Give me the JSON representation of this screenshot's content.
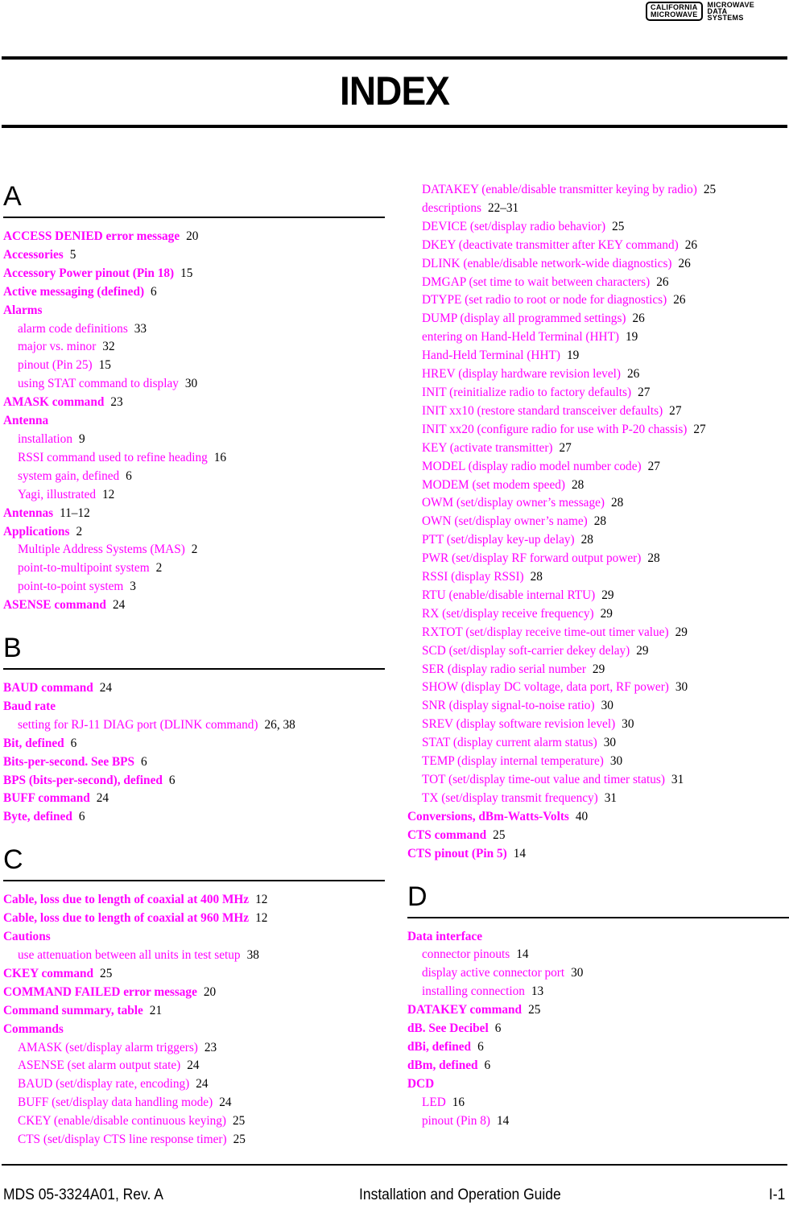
{
  "logo": {
    "box_line1": "CALIFORNIA",
    "box_line2": "MICROWAVE",
    "side_line1": "MICROWAVE",
    "side_line2": "DATA",
    "side_line3": "SYSTEMS"
  },
  "title": "INDEX",
  "colors": {
    "term": "#ff00ff",
    "pages": "#000000"
  },
  "sections": [
    {
      "letter": "A",
      "entries": [
        {
          "level": "main",
          "term": "ACCESS DENIED error message",
          "pages": "20"
        },
        {
          "level": "main",
          "term": "Accessories",
          "pages": "5"
        },
        {
          "level": "main",
          "term": "Accessory Power pinout (Pin 18)",
          "pages": "15"
        },
        {
          "level": "main",
          "term": "Active messaging (defined)",
          "pages": "6"
        },
        {
          "level": "main",
          "term": "Alarms",
          "pages": ""
        },
        {
          "level": "sub",
          "term": "alarm code definitions",
          "pages": "33"
        },
        {
          "level": "sub",
          "term": "major vs. minor",
          "pages": "32"
        },
        {
          "level": "sub",
          "term": "pinout (Pin 25)",
          "pages": "15"
        },
        {
          "level": "sub",
          "term": "using STAT command to display",
          "pages": "30"
        },
        {
          "level": "main",
          "term": "AMASK command",
          "pages": "23"
        },
        {
          "level": "main",
          "term": "Antenna",
          "pages": ""
        },
        {
          "level": "sub",
          "term": "installation",
          "pages": "9"
        },
        {
          "level": "sub",
          "term": "RSSI command used to refine heading",
          "pages": "16"
        },
        {
          "level": "sub",
          "term": "system gain, defined",
          "pages": "6"
        },
        {
          "level": "sub",
          "term": "Yagi, illustrated",
          "pages": "12"
        },
        {
          "level": "main",
          "term": "Antennas",
          "pages": "11–12"
        },
        {
          "level": "main",
          "term": "Applications",
          "pages": "2"
        },
        {
          "level": "sub",
          "term": "Multiple Address Systems (MAS)",
          "pages": "2"
        },
        {
          "level": "sub",
          "term": "point-to-multipoint system",
          "pages": "2"
        },
        {
          "level": "sub",
          "term": "point-to-point system",
          "pages": "3"
        },
        {
          "level": "main",
          "term": "ASENSE command",
          "pages": "24"
        }
      ]
    },
    {
      "letter": "B",
      "entries": [
        {
          "level": "main",
          "term": "BAUD command",
          "pages": "24"
        },
        {
          "level": "main",
          "term": "Baud rate",
          "pages": ""
        },
        {
          "level": "sub",
          "term": "setting for RJ-11 DIAG port (DLINK command)",
          "pages": "26, 38"
        },
        {
          "level": "main",
          "term": "Bit, defined",
          "pages": "6"
        },
        {
          "level": "main",
          "term": "Bits-per-second. See BPS",
          "pages": "6"
        },
        {
          "level": "main",
          "term": "BPS (bits-per-second), defined",
          "pages": "6"
        },
        {
          "level": "main",
          "term": "BUFF command",
          "pages": "24"
        },
        {
          "level": "main",
          "term": "Byte, defined",
          "pages": "6"
        }
      ]
    },
    {
      "letter": "C",
      "entries": [
        {
          "level": "main",
          "term": "Cable, loss due to length of coaxial at 400 MHz",
          "pages": "12"
        },
        {
          "level": "main",
          "term": "Cable, loss due to length of coaxial at 960 MHz",
          "pages": "12"
        },
        {
          "level": "main",
          "term": "Cautions",
          "pages": ""
        },
        {
          "level": "sub",
          "term": "use attenuation between all units in test setup",
          "pages": "38"
        },
        {
          "level": "main",
          "term": "CKEY command",
          "pages": "25"
        },
        {
          "level": "main",
          "term": "COMMAND FAILED error message",
          "pages": "20"
        },
        {
          "level": "main",
          "term": "Command summary, table",
          "pages": "21"
        },
        {
          "level": "main",
          "term": "Commands",
          "pages": ""
        },
        {
          "level": "sub",
          "term": "AMASK (set/display alarm triggers)",
          "pages": "23"
        },
        {
          "level": "sub",
          "term": "ASENSE (set alarm output state)",
          "pages": "24"
        },
        {
          "level": "sub",
          "term": "BAUD (set/display rate, encoding)",
          "pages": "24"
        },
        {
          "level": "sub",
          "term": "BUFF (set/display data handling mode)",
          "pages": "24"
        },
        {
          "level": "sub",
          "term": "CKEY (enable/disable continuous keying)",
          "pages": "25"
        },
        {
          "level": "sub",
          "term": "CTS (set/display CTS line response timer)",
          "pages": "25"
        }
      ]
    }
  ],
  "continued": {
    "entries": [
      {
        "level": "sub",
        "term": "DATAKEY (enable/disable transmitter keying by radio)",
        "pages": "25"
      },
      {
        "level": "sub",
        "term": "descriptions",
        "pages": "22–31"
      },
      {
        "level": "sub",
        "term": "DEVICE (set/display radio behavior)",
        "pages": "25"
      },
      {
        "level": "sub",
        "term": "DKEY (deactivate transmitter after KEY command)",
        "pages": "26"
      },
      {
        "level": "sub",
        "term": "DLINK (enable/disable network-wide diagnostics)",
        "pages": "26"
      },
      {
        "level": "sub",
        "term": "DMGAP (set time to wait between characters)",
        "pages": "26"
      },
      {
        "level": "sub",
        "term": "DTYPE (set radio to root or node for diagnostics)",
        "pages": "26"
      },
      {
        "level": "sub",
        "term": "DUMP (display all programmed settings)",
        "pages": "26"
      },
      {
        "level": "sub",
        "term": "entering on Hand-Held Terminal (HHT)",
        "pages": "19"
      },
      {
        "level": "sub",
        "term": "Hand-Held Terminal (HHT)",
        "pages": "19"
      },
      {
        "level": "sub",
        "term": "HREV (display hardware revision level)",
        "pages": "26"
      },
      {
        "level": "sub",
        "term": "INIT (reinitialize radio to factory defaults)",
        "pages": "27"
      },
      {
        "level": "sub",
        "term": "INIT xx10 (restore standard transceiver defaults)",
        "pages": "27"
      },
      {
        "level": "sub",
        "term": "INIT xx20 (configure radio for use with P-20 chassis)",
        "pages": "27"
      },
      {
        "level": "sub",
        "term": "KEY (activate transmitter)",
        "pages": "27"
      },
      {
        "level": "sub",
        "term": "MODEL (display radio model number code)",
        "pages": "27"
      },
      {
        "level": "sub",
        "term": "MODEM (set modem speed)",
        "pages": "28"
      },
      {
        "level": "sub",
        "term": "OWM (set/display owner’s message)",
        "pages": "28"
      },
      {
        "level": "sub",
        "term": "OWN (set/display owner’s name)",
        "pages": "28"
      },
      {
        "level": "sub",
        "term": "PTT (set/display key-up delay)",
        "pages": "28"
      },
      {
        "level": "sub",
        "term": "PWR (set/display RF forward output power)",
        "pages": "28"
      },
      {
        "level": "sub",
        "term": "RSSI (display RSSI)",
        "pages": "28"
      },
      {
        "level": "sub",
        "term": "RTU (enable/disable internal RTU)",
        "pages": "29"
      },
      {
        "level": "sub",
        "term": "RX (set/display receive frequency)",
        "pages": "29"
      },
      {
        "level": "sub",
        "term": "RXTOT (set/display receive time-out timer value)",
        "pages": "29"
      },
      {
        "level": "sub",
        "term": "SCD (set/display soft-carrier dekey delay)",
        "pages": "29"
      },
      {
        "level": "sub",
        "term": "SER (display radio serial number",
        "pages": "29"
      },
      {
        "level": "sub",
        "term": "SHOW (display DC voltage, data port, RF power)",
        "pages": "30"
      },
      {
        "level": "sub",
        "term": "SNR (display signal-to-noise ratio)",
        "pages": "30"
      },
      {
        "level": "sub",
        "term": "SREV (display software revision level)",
        "pages": "30"
      },
      {
        "level": "sub",
        "term": "STAT (display current alarm status)",
        "pages": "30"
      },
      {
        "level": "sub",
        "term": "TEMP (display internal temperature)",
        "pages": "30"
      },
      {
        "level": "sub",
        "term": "TOT (set/display time-out value and timer status)",
        "pages": "31"
      },
      {
        "level": "sub",
        "term": "TX (set/display transmit frequency)",
        "pages": "31"
      },
      {
        "level": "main",
        "term": "Conversions, dBm-Watts-Volts",
        "pages": "40"
      },
      {
        "level": "main",
        "term": "CTS command",
        "pages": "25"
      },
      {
        "level": "main",
        "term": "CTS pinout (Pin 5)",
        "pages": "14"
      }
    ]
  },
  "section_d": {
    "letter": "D",
    "entries": [
      {
        "level": "main",
        "term": "Data interface",
        "pages": ""
      },
      {
        "level": "sub",
        "term": "connector pinouts",
        "pages": "14"
      },
      {
        "level": "sub",
        "term": "display active connector port",
        "pages": "30"
      },
      {
        "level": "sub",
        "term": "installing connection",
        "pages": "13"
      },
      {
        "level": "main",
        "term": "DATAKEY command",
        "pages": "25"
      },
      {
        "level": "main",
        "term": "dB. See Decibel",
        "pages": "6"
      },
      {
        "level": "main",
        "term": "dBi, defined",
        "pages": "6"
      },
      {
        "level": "main",
        "term": "dBm, defined",
        "pages": "6"
      },
      {
        "level": "main",
        "term": "DCD",
        "pages": ""
      },
      {
        "level": "sub",
        "term": "LED",
        "pages": "16"
      },
      {
        "level": "sub",
        "term": "pinout (Pin 8)",
        "pages": "14"
      }
    ]
  },
  "footer": {
    "doc_number": "MDS 05-3324A01, Rev. A",
    "doc_title": "Installation and Operation Guide",
    "page_number": "I-1"
  }
}
